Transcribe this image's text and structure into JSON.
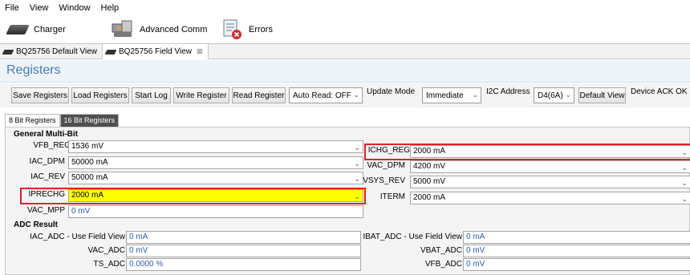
{
  "menu": [
    "File",
    "View",
    "Window",
    "Help"
  ],
  "toolbar": {
    "charger": "Charger",
    "advanced_comm": "Advanced Comm",
    "errors": "Errors"
  },
  "views": [
    {
      "label": "BQ25756 Default View"
    },
    {
      "label": "BQ25756 Field View",
      "close": "⊠"
    }
  ],
  "page_title": "Registers",
  "controls": {
    "save": "Save Registers",
    "load": "Load Registers",
    "start_log": "Start Log",
    "write": "Write Register",
    "read": "Read Register",
    "auto_read": "Auto Read: OFF",
    "update_mode_label": "Update Mode",
    "update_mode_value": "Immediate",
    "i2c_label": "I2C Address",
    "i2c_value": "D4(6A)",
    "default_view": "Default View",
    "device_status": "Device ACK OK"
  },
  "reg_tabs": [
    "8 Bit Registers",
    "16 Bit Registers"
  ],
  "general": {
    "title": "General Multi-Bit",
    "left": [
      {
        "label": "VFB_REG",
        "value": "1536 mV"
      },
      {
        "label": "IAC_DPM",
        "value": "50000 mA"
      },
      {
        "label": "IAC_REV",
        "value": "50000 mA"
      },
      {
        "label": "IPRECHG",
        "value": "2000 mA"
      },
      {
        "label": "VAC_MPP",
        "value": "0 mV"
      }
    ],
    "right": [
      {
        "label": "ICHG_REG",
        "value": "2000 mA"
      },
      {
        "label": "VAC_DPM",
        "value": "4200 mV"
      },
      {
        "label": "VSYS_REV",
        "value": "5000 mV"
      },
      {
        "label": "ITERM",
        "value": "2000 mA"
      }
    ]
  },
  "adc": {
    "title": "ADC Result",
    "left": [
      {
        "label": "IAC_ADC - Use Field View",
        "value": "0 mA"
      },
      {
        "label": "VAC_ADC",
        "value": "0 mV"
      },
      {
        "label": "TS_ADC",
        "value": "0.0000 %"
      }
    ],
    "right": [
      {
        "label": "IBAT_ADC - Use Field View",
        "value": "0 mA"
      },
      {
        "label": "VBAT_ADC",
        "value": "0 mV"
      },
      {
        "label": "VFB_ADC",
        "value": "0 mV"
      }
    ]
  },
  "colors": {
    "title_blue": "#4a78b4",
    "value_blue": "#2b5db5",
    "highlight_red": "#e0202b",
    "highlight_yellow": "#ffff00"
  }
}
